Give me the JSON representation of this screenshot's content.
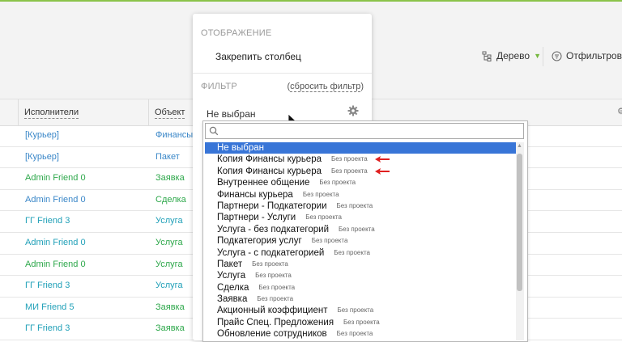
{
  "toolbar": {
    "tree_label": "Дерево",
    "filter_label": "Отфильтроват"
  },
  "table": {
    "headers": [
      "Исполнители",
      "Объект"
    ],
    "rows": [
      {
        "executor": "[Курьер]",
        "executor_color": "blue",
        "object": "Финансы ку",
        "object_color": "blue"
      },
      {
        "executor": "[Курьер]",
        "executor_color": "blue",
        "object": "Пакет",
        "object_color": "blue"
      },
      {
        "executor": "Admin Friend 0",
        "executor_color": "green",
        "object": "Заявка",
        "object_color": "green"
      },
      {
        "executor": "Admin Friend 0",
        "executor_color": "blue",
        "object": "Сделка",
        "object_color": "green"
      },
      {
        "executor": "ГГ Friend 3",
        "executor_color": "cyan",
        "object": "Услуга",
        "object_color": "cyan"
      },
      {
        "executor": "Admin Friend 0",
        "executor_color": "cyan",
        "object": "Услуга",
        "object_color": "green"
      },
      {
        "executor": "Admin Friend 0",
        "executor_color": "green",
        "object": "Услуга",
        "object_color": "green"
      },
      {
        "executor": "ГГ Friend 3",
        "executor_color": "cyan",
        "object": "Услуга",
        "object_color": "cyan"
      },
      {
        "executor": "МИ Friend 5",
        "executor_color": "cyan",
        "object": "Заявка",
        "object_color": "green"
      },
      {
        "executor": "ГГ Friend 3",
        "executor_color": "cyan",
        "object": "Заявка",
        "object_color": "green"
      }
    ]
  },
  "panel": {
    "display_section": "ОТОБРАЖЕНИЕ",
    "pin_column": "Закрепить столбец",
    "filter_section": "ФИЛЬТР",
    "reset_filter": "сбросить фильтр",
    "reset_open": "(",
    "reset_close": ")",
    "current_value": "Не выбран"
  },
  "dropdown": {
    "search_value": "",
    "options": [
      {
        "label": "Не выбран",
        "project": "",
        "selected": true
      },
      {
        "label": "Копия Финансы курьера",
        "project": "Без проекта",
        "arrow": true
      },
      {
        "label": "Копия Финансы курьера",
        "project": "Без проекта",
        "arrow": true
      },
      {
        "label": "Внутреннее общение",
        "project": "Без проекта"
      },
      {
        "label": "Финансы курьера",
        "project": "Без проекта"
      },
      {
        "label": "Партнери - Подкатегории",
        "project": "Без проекта"
      },
      {
        "label": "Партнери - Услуги",
        "project": "Без проекта"
      },
      {
        "label": "Услуга - без подкатегорий",
        "project": "Без проекта"
      },
      {
        "label": "Подкатегория услуг",
        "project": "Без проекта"
      },
      {
        "label": "Услуга - с подкатегорией",
        "project": "Без проекта"
      },
      {
        "label": "Пакет",
        "project": "Без проекта"
      },
      {
        "label": "Услуга",
        "project": "Без проекта"
      },
      {
        "label": "Сделка",
        "project": "Без проекта"
      },
      {
        "label": "Заявка",
        "project": "Без проекта"
      },
      {
        "label": "Акционный коэффициент",
        "project": "Без проекта"
      },
      {
        "label": "Прайс Спец. Предложения",
        "project": "Без проекта"
      },
      {
        "label": "Обновление сотрудников",
        "project": "Без проекта"
      }
    ]
  },
  "colors": {
    "accent_green": "#8bc34a",
    "selected_blue": "#3875d7",
    "arrow_red": "#e02020"
  }
}
